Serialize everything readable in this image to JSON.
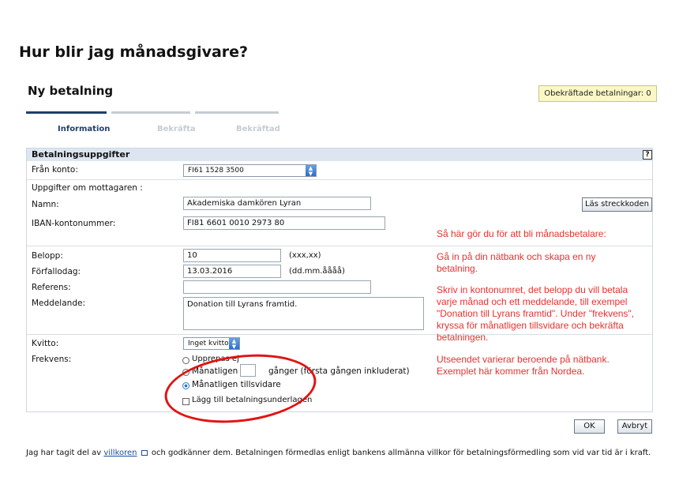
{
  "page_title": "Hur blir jag månadsgivare?",
  "form_title": "Ny betalning",
  "unconfirmed_label": "Obekräftade betalningar: 0",
  "steps": [
    {
      "label": "Information",
      "active": true
    },
    {
      "label": "Bekräfta",
      "active": false
    },
    {
      "label": "Bekräftad",
      "active": false
    }
  ],
  "panel": {
    "title": "Betalningsuppgifter",
    "help": "?"
  },
  "fields": {
    "from_account": {
      "label": "Från konto:",
      "value": "FI61 1528 3500"
    },
    "recipient_heading": "Uppgifter om mottagaren :",
    "name": {
      "label": "Namn:",
      "value": "Akademiska damkören Lyran"
    },
    "iban": {
      "label": "IBAN-kontonummer:",
      "value": "FI81 6601 0010 2973 80"
    },
    "amount": {
      "label": "Belopp:",
      "value": "10",
      "hint": "(xxx,xx)"
    },
    "due_date": {
      "label": "Förfallodag:",
      "value": "13.03.2016",
      "hint": "(dd.mm.åååå)"
    },
    "reference": {
      "label": "Referens:",
      "value": ""
    },
    "message": {
      "label": "Meddelande:",
      "value": "Donation till Lyrans framtid."
    },
    "receipt": {
      "label": "Kvitto:",
      "value": "Inget kvitto"
    },
    "frequency": {
      "label": "Frekvens:",
      "once_label": "Upprepas ej",
      "monthly_label": "Månatligen",
      "monthly_count": "",
      "monthly_suffix": "gånger (första gången inkluderat)",
      "until_further_label": "Månatligen tillsvidare",
      "selected": "until_further"
    },
    "add_to_list": "Lägg till betalningsunderlagen"
  },
  "buttons": {
    "scan_barcode": "Läs streckkoden",
    "ok": "OK",
    "cancel": "Avbryt"
  },
  "instructions": {
    "heading": "Så här gör du för att bli månadsbetalare:",
    "para1_l1": "Gå in på din nätbank och skapa en ny",
    "para1_l2": "betalning.",
    "para2_l1": "Skriv in kontonumret, det belopp du vill betala",
    "para2_l2": "varje månad och ett meddelande, till exempel",
    "para2_l3": "\"Donation till Lyrans framtid\". Under \"frekvens\",",
    "para2_l4": "kryssa för månatligen tillsvidare och bekräfta",
    "para2_l5": "betalningen.",
    "para3_l1": "Utseendet varierar beroende på nätbank.",
    "para3_l2": "Exemplet här kommer från Nordea."
  },
  "footer": {
    "before": "Jag har tagit del av",
    "link": "villkoren",
    "after": "och godkänner dem. Betalningen förmedlas enligt bankens allmänna villkor för betalningsförmedling som vid var tid är i kraft."
  },
  "colors": {
    "annotation_red": "#e8312f",
    "step_active": "#1f3f6e",
    "step_inactive": "#c5ccd4",
    "panel_header_bg": "#dde6f0",
    "notice_bg": "#fbf8c6"
  }
}
